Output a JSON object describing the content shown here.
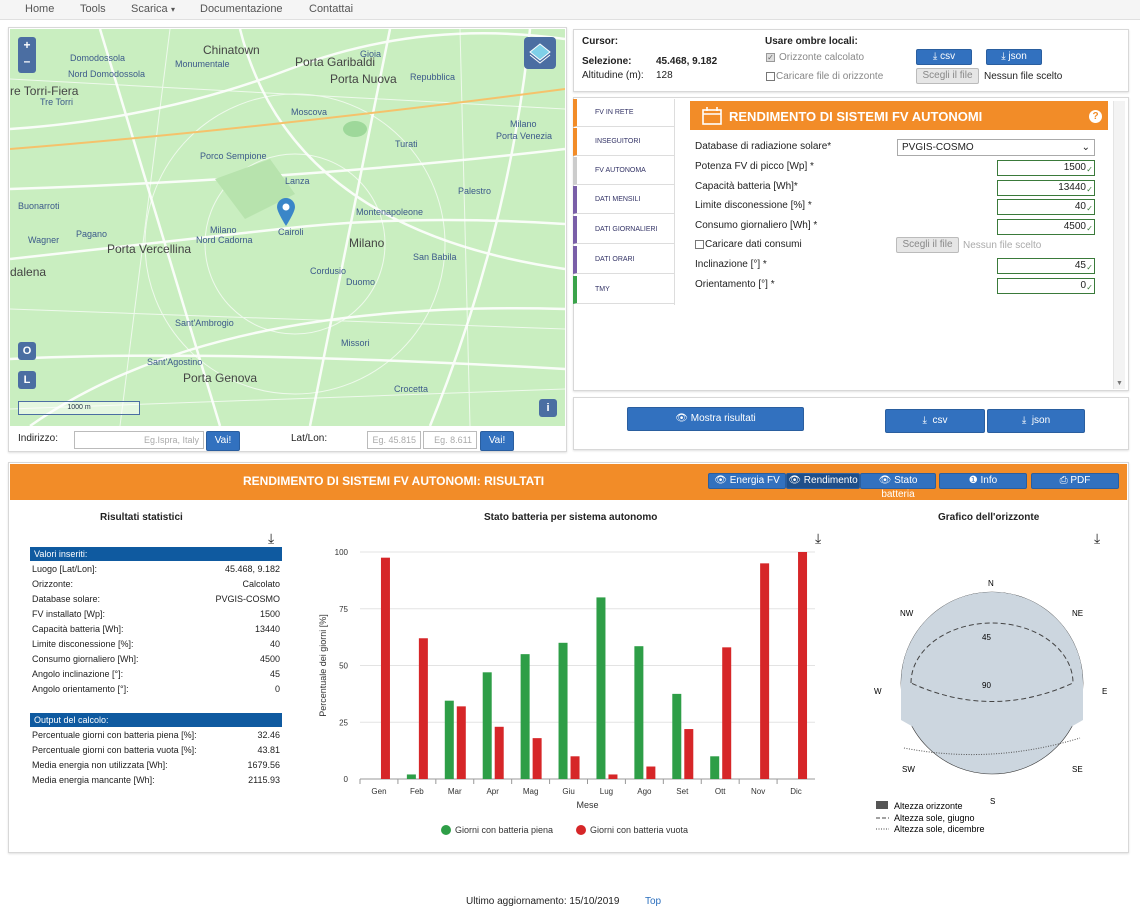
{
  "nav": {
    "items": [
      "Home",
      "Tools",
      "Scarica",
      "Documentazione",
      "Contattai"
    ]
  },
  "map": {
    "zoom_in": "+",
    "zoom_out": "–",
    "btn_o": "O",
    "btn_l": "L",
    "info": "i",
    "scale": "1000 m",
    "labels": [
      {
        "t": "Chinatown",
        "big": true
      },
      {
        "t": "Porta Garibaldi",
        "big": true
      },
      {
        "t": "Porta Nuova",
        "big": true
      },
      {
        "t": "Domodossola",
        "big": false
      },
      {
        "t": "Nord Domodossola",
        "big": false
      },
      {
        "t": "re Torri-Fiera",
        "big": true
      },
      {
        "t": "Tre Torri",
        "big": false
      },
      {
        "t": "Monumentale",
        "big": false
      },
      {
        "t": "Gioia",
        "big": false
      },
      {
        "t": "Repubblica",
        "big": false
      },
      {
        "t": "Moscova",
        "big": false
      },
      {
        "t": "Milano",
        "big": false
      },
      {
        "t": "Porta Venezia",
        "big": false
      },
      {
        "t": "Porco Sempione",
        "big": false
      },
      {
        "t": "Turati",
        "big": false
      },
      {
        "t": "Lanza",
        "big": false
      },
      {
        "t": "Palestro",
        "big": false
      },
      {
        "t": "Buonarroti",
        "big": false
      },
      {
        "t": "Montenapoleone",
        "big": false
      },
      {
        "t": "Cairoli",
        "big": false
      },
      {
        "t": "Wagner",
        "big": false
      },
      {
        "t": "Pagano",
        "big": false
      },
      {
        "t": "Milano",
        "big": false
      },
      {
        "t": "Nord Cadorna",
        "big": false
      },
      {
        "t": "Milano",
        "big": true
      },
      {
        "t": "Porta Vercellina",
        "big": true
      },
      {
        "t": "San Babila",
        "big": false
      },
      {
        "t": "dalena",
        "big": true
      },
      {
        "t": "Cordusio",
        "big": false
      },
      {
        "t": "Duomo",
        "big": false
      },
      {
        "t": "Sant'Ambrogio",
        "big": false
      },
      {
        "t": "Missori",
        "big": false
      },
      {
        "t": "Sant'Agostino",
        "big": false
      },
      {
        "t": "Porta Genova",
        "big": true
      },
      {
        "t": "Crocetta",
        "big": false
      }
    ]
  },
  "address": {
    "label": "Indirizzo:",
    "placeholder": "Eg.Ispra, Italy",
    "go": "Vai!",
    "latlon_label": "Lat/Lon:",
    "lat_placeholder": "Eg. 45.815",
    "lon_placeholder": "Eg. 8.611",
    "go2": "Vai!"
  },
  "info": {
    "cursor_label": "Cursor:",
    "selection_label": "Selezione:",
    "selection_value": "45.468, 9.182",
    "altitude_label": "Altitudine (m):",
    "altitude_value": "128",
    "shadows_label": "Usare ombre locali:",
    "horizon_calc": "Orizzonte calcolato",
    "horizon_file": "Caricare file di orizzonte",
    "choose_file": "Scegli il file",
    "no_file": "Nessun file scelto",
    "csv": "csv",
    "json": "json"
  },
  "tabs": [
    "FV IN RETE",
    "INSEGUITORI",
    "FV AUTONOMA",
    "DATI MENSILI",
    "DATI GIORNALIERI",
    "DATI ORARI",
    "TMY"
  ],
  "form": {
    "title": "RENDIMENTO DI SISTEMI FV AUTONOMI",
    "db_label": "Database di radiazione solare*",
    "db_value": "PVGIS-COSMO",
    "power_label": "Potenza FV di picco [Wp] *",
    "power_value": "1500",
    "battery_label": "Capacità batteria [Wh]*",
    "battery_value": "13440",
    "cutoff_label": "Limite disconessione [%] *",
    "cutoff_value": "40",
    "consumption_label": "Consumo giornaliero [Wh] *",
    "consumption_value": "4500",
    "load_label": "Caricare dati consumi",
    "load_choose": "Scegli il file",
    "load_none": "Nessun file scelto",
    "tilt_label": "Inclinazione [°] *",
    "tilt_value": "45",
    "azimuth_label": "Orientamento [°] *",
    "azimuth_value": "0"
  },
  "actions": {
    "show": "Mostra risultati",
    "csv": "csv",
    "json": "json"
  },
  "results": {
    "title": "RENDIMENTO DI SISTEMI FV AUTONOMI: RISULTATI",
    "btn_energy": "Energia FV",
    "btn_perf": "Rendimento",
    "btn_battery": "Stato batteria",
    "btn_info": "Info",
    "btn_pdf": "PDF",
    "stats_title": "Risultati statistici",
    "inputs_head": "Valori inseriti:",
    "inputs": [
      {
        "k": "Luogo [Lat/Lon]:",
        "v": "45.468, 9.182"
      },
      {
        "k": "Orizzonte:",
        "v": "Calcolato"
      },
      {
        "k": "Database solare:",
        "v": "PVGIS-COSMO"
      },
      {
        "k": "FV installato [Wp]:",
        "v": "1500"
      },
      {
        "k": "Capacità batteria [Wh]:",
        "v": "13440"
      },
      {
        "k": "Limite disconessione [%]:",
        "v": "40"
      },
      {
        "k": "Consumo giornaliero [Wh]:",
        "v": "4500"
      },
      {
        "k": "Angolo inclinazione [°]:",
        "v": "45"
      },
      {
        "k": "Angolo orientamento [°]:",
        "v": "0"
      }
    ],
    "outputs_head": "Output del calcolo:",
    "outputs": [
      {
        "k": "Percentuale giorni con batteria piena [%]:",
        "v": "32.46"
      },
      {
        "k": "Percentuale giorni con batteria vuota [%]:",
        "v": "43.81"
      },
      {
        "k": "Media energia non utilizzata [Wh]:",
        "v": "1679.56"
      },
      {
        "k": "Media energia mancante [Wh]:",
        "v": "2115.93"
      }
    ],
    "horizon_title": "Grafico dell'orizzonte",
    "horizon": {
      "n": "N",
      "ne": "NE",
      "e": "E",
      "se": "SE",
      "s": "S",
      "sw": "SW",
      "w": "W",
      "nw": "NW",
      "r45": "45",
      "r90": "90",
      "legend": [
        "Altezza orizzonte",
        "Altezza sole, giugno",
        "Altezza sole, dicembre"
      ]
    }
  },
  "chart_data": {
    "type": "bar",
    "title": "Stato batteria per sistema autonomo",
    "xlabel": "Mese",
    "ylabel": "Percentuale dei giorni [%]",
    "categories": [
      "Gen",
      "Feb",
      "Mar",
      "Apr",
      "Mag",
      "Giu",
      "Lug",
      "Ago",
      "Set",
      "Ott",
      "Nov",
      "Dic"
    ],
    "ylim": [
      0,
      100
    ],
    "yticks": [
      0,
      25,
      50,
      75,
      100
    ],
    "series": [
      {
        "name": "Giorni con batteria piena",
        "color": "#2e9e47",
        "values": [
          0,
          2,
          34.5,
          47,
          55,
          60,
          80,
          58.5,
          37.5,
          10,
          0,
          0
        ]
      },
      {
        "name": "Giorni con batteria vuota",
        "color": "#d62628",
        "values": [
          97.5,
          62,
          32,
          23,
          18,
          10,
          2,
          5.5,
          22,
          58,
          95,
          100
        ]
      }
    ]
  },
  "footer": {
    "text": "Ultimo aggiornamento: 15/10/2019",
    "top": "Top"
  }
}
